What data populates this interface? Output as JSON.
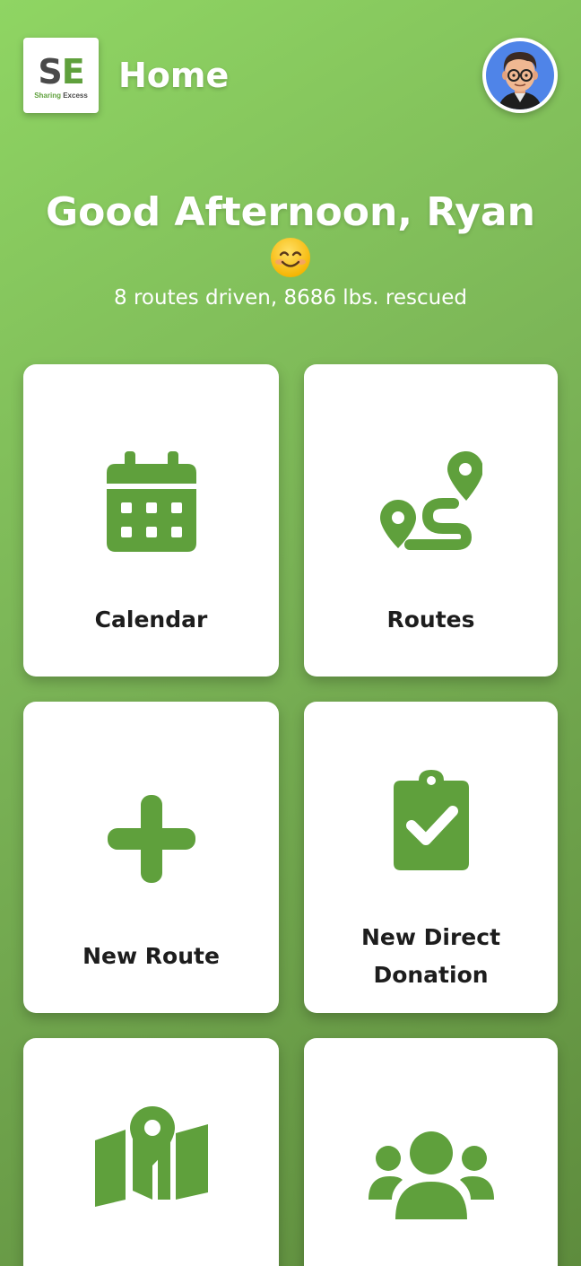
{
  "header": {
    "logo": {
      "s": "S",
      "e": "E",
      "sub_sharing": "Sharing",
      "sub_excess": "Excess"
    },
    "title": "Home"
  },
  "greeting": {
    "text": "Good Afternoon, Ryan",
    "emoji": "smiling-face",
    "stats": "8 routes driven, 8686 lbs. rescued"
  },
  "tiles": [
    {
      "label": "Calendar",
      "icon": "calendar-icon"
    },
    {
      "label": "Routes",
      "icon": "route-icon"
    },
    {
      "label": "New Route",
      "icon": "plus-icon"
    },
    {
      "label_line1": "New Direct",
      "label_line2": "Donation",
      "icon": "clipboard-check-icon"
    },
    {
      "label": "",
      "icon": "map-icon"
    },
    {
      "label": "",
      "icon": "people-icon"
    }
  ],
  "colors": {
    "accent": "#5fa03c",
    "background_start": "#8fd563",
    "background_end": "#5e8c3d",
    "avatar_bg": "#4f84e8"
  }
}
